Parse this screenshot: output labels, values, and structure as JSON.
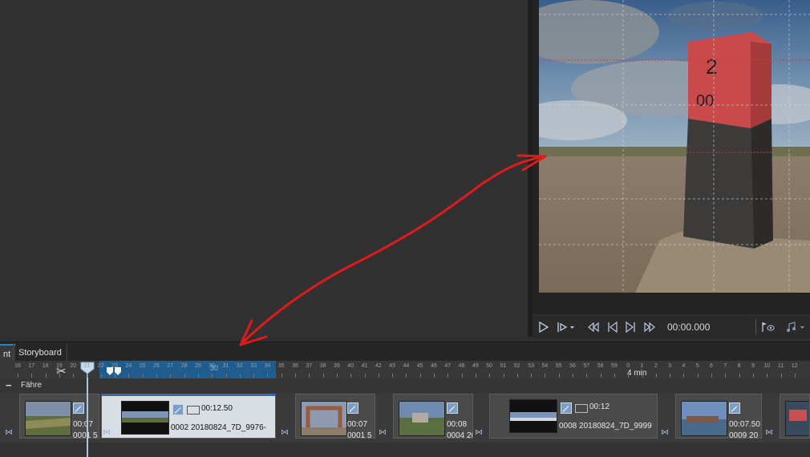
{
  "preview": {
    "timecode": "00:00.000",
    "post_number_top": "2",
    "post_number_bottom": "00"
  },
  "tabs": {
    "cut_partial": "nt",
    "storyboard": "Storyboard"
  },
  "ruler": {
    "ticks": [
      "16",
      "17",
      "18",
      "19",
      "20",
      "21",
      "22",
      "23",
      "24",
      "25",
      "26",
      "27",
      "28",
      "29",
      "30",
      "31",
      "32",
      "33",
      "34",
      "35",
      "36",
      "37",
      "38",
      "39",
      "40",
      "41",
      "42",
      "43",
      "44",
      "45",
      "46",
      "47",
      "48",
      "49",
      "50",
      "51",
      "52",
      "53",
      "54",
      "55",
      "56",
      "57",
      "58",
      "59",
      "0",
      "1",
      "2",
      "3",
      "4",
      "5",
      "6",
      "7",
      "8",
      "9",
      "10",
      "11",
      "12"
    ],
    "major_label": "4 min",
    "highlight_label": "30"
  },
  "track": {
    "name": "Fähre",
    "collapse_symbol": "−"
  },
  "clips": [
    {
      "duration": "00:07",
      "name": "0001 5",
      "selected": false
    },
    {
      "duration": "00:12.50",
      "name": "0002 20180824_7D_9976-",
      "selected": true
    },
    {
      "duration": "00:07",
      "name": "0001 5",
      "selected": false
    },
    {
      "duration": "00:08",
      "name": "0004 2018",
      "selected": false
    },
    {
      "duration": "00:12",
      "name": "0008 20180824_7D_9999",
      "selected": false
    },
    {
      "duration": "00:07.50",
      "name": "0009 20",
      "selected": false
    }
  ],
  "colors": {
    "selection": "#1f5d8e",
    "arrow": "#e01a1a",
    "clip_selected": "#d9dee5"
  }
}
